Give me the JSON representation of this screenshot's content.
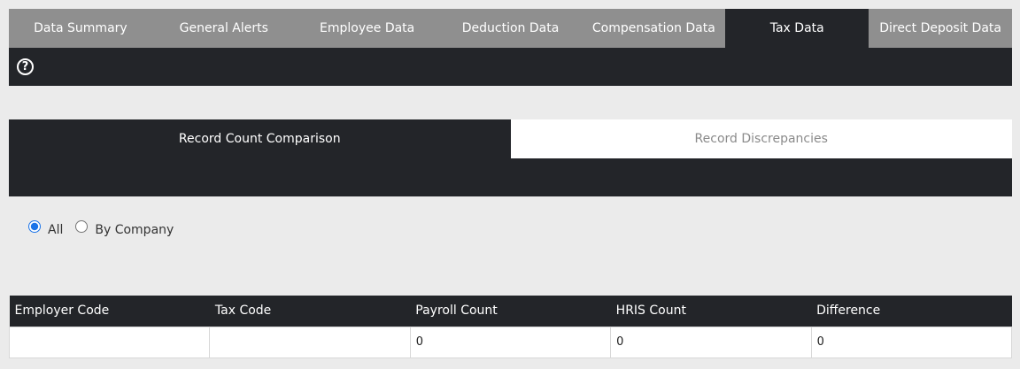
{
  "top_tabs": [
    {
      "label": "Data Summary",
      "active": false
    },
    {
      "label": "General Alerts",
      "active": false
    },
    {
      "label": "Employee Data",
      "active": false
    },
    {
      "label": "Deduction Data",
      "active": false
    },
    {
      "label": "Compensation Data",
      "active": false
    },
    {
      "label": "Tax Data",
      "active": true
    },
    {
      "label": "Direct Deposit Data",
      "active": false
    }
  ],
  "help": {
    "icon": "question-circle-icon",
    "glyph": "?"
  },
  "sub_tabs": [
    {
      "label": "Record Count Comparison",
      "active": true
    },
    {
      "label": "Record Discrepancies",
      "active": false
    }
  ],
  "filter": {
    "options": [
      {
        "label": "All",
        "selected": true
      },
      {
        "label": "By Company",
        "selected": false
      }
    ]
  },
  "table": {
    "columns": [
      "Employer Code",
      "Tax Code",
      "Payroll Count",
      "HRIS Count",
      "Difference"
    ],
    "rows": [
      [
        "",
        "",
        "0",
        "0",
        "0"
      ]
    ]
  },
  "colors": {
    "dark": "#232529",
    "tab_gray": "#8f8f8f",
    "background": "#ebebeb",
    "radio_accent": "#1a73e8"
  }
}
